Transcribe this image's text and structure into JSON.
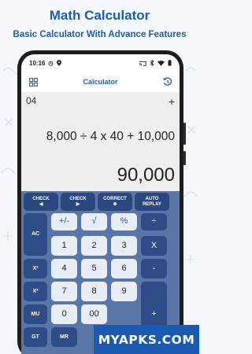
{
  "promo": {
    "title": "Math Calculator",
    "subtitle": "Basic Calculator With Advance Features"
  },
  "status_bar": {
    "time": "10:16"
  },
  "app_bar": {
    "title": "Calculator",
    "left_icon": "grid-icon",
    "right_icon": "history-icon"
  },
  "display": {
    "count": "04",
    "plus": "+",
    "expression": "8,000 ÷ 4 x 40 + 10,000",
    "result": "90,000"
  },
  "keys": {
    "check_prev": "CHECK",
    "check_prev_arrow": "◀",
    "check_next": "CHECK",
    "check_next_arrow": "▶",
    "correct": "CORRECT",
    "correct_sub": "⊗",
    "auto_replay_1": "AUTO",
    "auto_replay_2": "REPLAY",
    "ac": "AC",
    "plus_minus": "+/-",
    "sqrt": "√",
    "percent": "%",
    "divide": "÷",
    "x2": "X²",
    "x3": "X³",
    "mu": "MU",
    "gt": "GT",
    "mr": "MR",
    "n1": "1",
    "n2": "2",
    "n3": "3",
    "n4": "4",
    "n5": "5",
    "n6": "6",
    "n7": "7",
    "n8": "8",
    "n9": "9",
    "n0": "0",
    "n00": "00",
    "multiply": "X",
    "minus": "-",
    "plus": "+"
  },
  "watermark": "MYAPKS.COM",
  "colors": {
    "brand": "#1f5ea8",
    "keypad_bg": "#5a76a8",
    "dark_key": "#2b4780",
    "light_key": "#e9eef6"
  }
}
